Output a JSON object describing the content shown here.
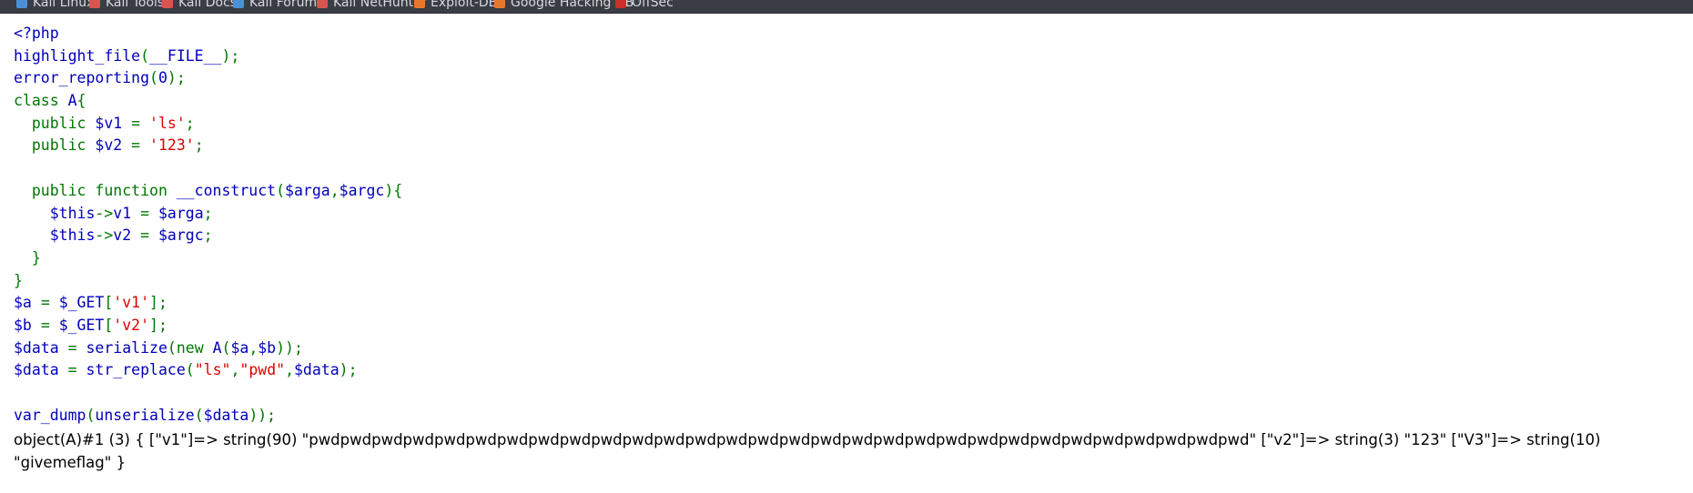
{
  "bookmarks": {
    "items": [
      {
        "label": "Kali Linux",
        "icon": "kali-dragon-icon",
        "color": "#4a90d9"
      },
      {
        "label": "Kali Tools",
        "icon": "kali-tools-icon",
        "color": "#d9534f"
      },
      {
        "label": "Kali Docs",
        "icon": "kali-docs-icon",
        "color": "#d9534f"
      },
      {
        "label": "Kali Forums",
        "icon": "kali-forums-icon",
        "color": "#4a90d9"
      },
      {
        "label": "Kali NetHunter",
        "icon": "kali-nethunter-icon",
        "color": "#d9534f"
      },
      {
        "label": "Exploit-DB",
        "icon": "exploit-db-icon",
        "color": "#e8772e"
      },
      {
        "label": "Google Hacking DB",
        "icon": "ghdb-icon",
        "color": "#e8772e"
      },
      {
        "label": "OffSec",
        "icon": "offsec-icon",
        "color": "#c9302c"
      }
    ]
  },
  "code": {
    "colors": {
      "default": "#0000bb",
      "keyword": "#007700",
      "string": "#dd0000"
    },
    "lines": [
      [
        {
          "t": "<?php",
          "c": "def"
        }
      ],
      [
        {
          "t": "highlight_file",
          "c": "def"
        },
        {
          "t": "(",
          "c": "kw"
        },
        {
          "t": "__FILE__",
          "c": "def"
        },
        {
          "t": ");",
          "c": "kw"
        }
      ],
      [
        {
          "t": "error_reporting",
          "c": "def"
        },
        {
          "t": "(",
          "c": "kw"
        },
        {
          "t": "0",
          "c": "def"
        },
        {
          "t": ");",
          "c": "kw"
        }
      ],
      [
        {
          "t": "class ",
          "c": "kw"
        },
        {
          "t": "A",
          "c": "def"
        },
        {
          "t": "{",
          "c": "kw"
        }
      ],
      [
        {
          "t": "  public ",
          "c": "kw"
        },
        {
          "t": "$v1 ",
          "c": "def"
        },
        {
          "t": "= ",
          "c": "kw"
        },
        {
          "t": "'ls'",
          "c": "str"
        },
        {
          "t": ";",
          "c": "kw"
        }
      ],
      [
        {
          "t": "  public ",
          "c": "kw"
        },
        {
          "t": "$v2 ",
          "c": "def"
        },
        {
          "t": "= ",
          "c": "kw"
        },
        {
          "t": "'123'",
          "c": "str"
        },
        {
          "t": ";",
          "c": "kw"
        }
      ],
      [],
      [
        {
          "t": "  public function ",
          "c": "kw"
        },
        {
          "t": "__construct",
          "c": "def"
        },
        {
          "t": "(",
          "c": "kw"
        },
        {
          "t": "$arga",
          "c": "def"
        },
        {
          "t": ",",
          "c": "kw"
        },
        {
          "t": "$argc",
          "c": "def"
        },
        {
          "t": "){",
          "c": "kw"
        }
      ],
      [
        {
          "t": "    ",
          "c": "kw"
        },
        {
          "t": "$this",
          "c": "def"
        },
        {
          "t": "->",
          "c": "kw"
        },
        {
          "t": "v1 ",
          "c": "def"
        },
        {
          "t": "= ",
          "c": "kw"
        },
        {
          "t": "$arga",
          "c": "def"
        },
        {
          "t": ";",
          "c": "kw"
        }
      ],
      [
        {
          "t": "    ",
          "c": "kw"
        },
        {
          "t": "$this",
          "c": "def"
        },
        {
          "t": "->",
          "c": "kw"
        },
        {
          "t": "v2 ",
          "c": "def"
        },
        {
          "t": "= ",
          "c": "kw"
        },
        {
          "t": "$argc",
          "c": "def"
        },
        {
          "t": ";",
          "c": "kw"
        }
      ],
      [
        {
          "t": "  }",
          "c": "kw"
        }
      ],
      [
        {
          "t": "}",
          "c": "kw"
        }
      ],
      [
        {
          "t": "$a ",
          "c": "def"
        },
        {
          "t": "= ",
          "c": "kw"
        },
        {
          "t": "$_GET",
          "c": "def"
        },
        {
          "t": "[",
          "c": "kw"
        },
        {
          "t": "'v1'",
          "c": "str"
        },
        {
          "t": "];",
          "c": "kw"
        }
      ],
      [
        {
          "t": "$b ",
          "c": "def"
        },
        {
          "t": "= ",
          "c": "kw"
        },
        {
          "t": "$_GET",
          "c": "def"
        },
        {
          "t": "[",
          "c": "kw"
        },
        {
          "t": "'v2'",
          "c": "str"
        },
        {
          "t": "];",
          "c": "kw"
        }
      ],
      [
        {
          "t": "$data ",
          "c": "def"
        },
        {
          "t": "= ",
          "c": "kw"
        },
        {
          "t": "serialize",
          "c": "def"
        },
        {
          "t": "(new ",
          "c": "kw"
        },
        {
          "t": "A",
          "c": "def"
        },
        {
          "t": "(",
          "c": "kw"
        },
        {
          "t": "$a",
          "c": "def"
        },
        {
          "t": ",",
          "c": "kw"
        },
        {
          "t": "$b",
          "c": "def"
        },
        {
          "t": "));",
          "c": "kw"
        }
      ],
      [
        {
          "t": "$data ",
          "c": "def"
        },
        {
          "t": "= ",
          "c": "kw"
        },
        {
          "t": "str_replace",
          "c": "def"
        },
        {
          "t": "(",
          "c": "kw"
        },
        {
          "t": "\"ls\"",
          "c": "str"
        },
        {
          "t": ",",
          "c": "kw"
        },
        {
          "t": "\"pwd\"",
          "c": "str"
        },
        {
          "t": ",",
          "c": "kw"
        },
        {
          "t": "$data",
          "c": "def"
        },
        {
          "t": ");",
          "c": "kw"
        }
      ],
      [],
      [
        {
          "t": "var_dump",
          "c": "def"
        },
        {
          "t": "(",
          "c": "kw"
        },
        {
          "t": "unserialize",
          "c": "def"
        },
        {
          "t": "(",
          "c": "kw"
        },
        {
          "t": "$data",
          "c": "def"
        },
        {
          "t": "));",
          "c": "kw"
        }
      ]
    ]
  },
  "output": {
    "text": "object(A)#1 (3) { [\"v1\"]=> string(90) \"pwdpwdpwdpwdpwdpwdpwdpwdpwdpwdpwdpwdpwdpwdpwdpwdpwdpwdpwdpwdpwdpwdpwdpwdpwdpwdpwdpwdpwdpwd\" [\"v2\"]=> string(3) \"123\" [\"V3\"]=> string(10) \"givemeflag\" }"
  }
}
